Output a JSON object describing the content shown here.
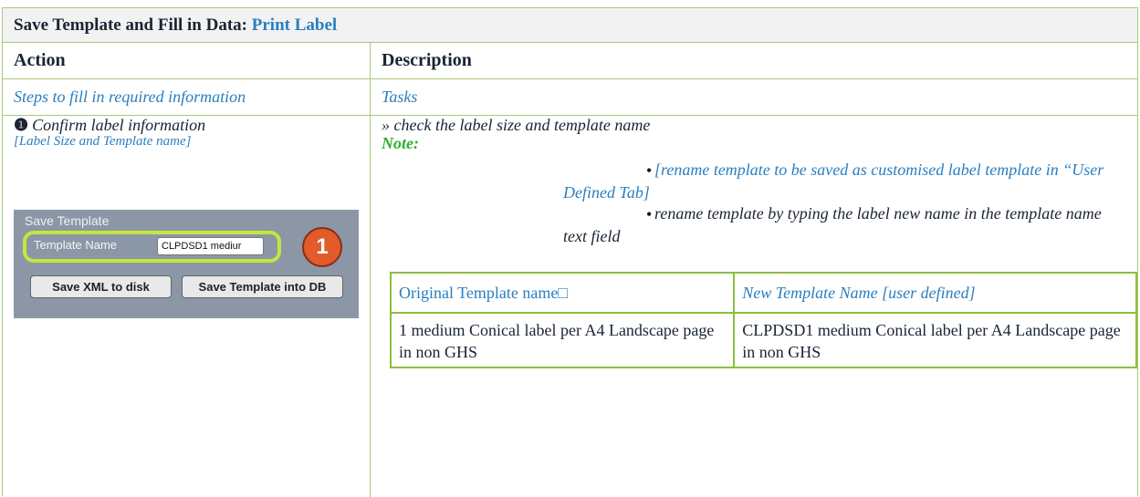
{
  "title": {
    "prefix": "Save Template and Fill in Data: ",
    "highlight": "Print Label"
  },
  "headers": {
    "action": "Action",
    "description": "Description"
  },
  "subheaders": {
    "action": "Steps to fill in required information",
    "description": "Tasks"
  },
  "step": {
    "number_glyph": "❶",
    "label": "Confirm label information",
    "sub": "[Label Size and Template name]"
  },
  "screenshot": {
    "section_title": "Save Template",
    "field_label": "Template Name",
    "field_value": "CLPDSD1 mediur",
    "badge": "1",
    "button_xml": "Save XML to disk",
    "button_db": "Save Template into DB"
  },
  "description": {
    "check": "» check the label size and template name",
    "note": "Note:",
    "bullets": [
      "[rename template to be saved as customised label template in “User Defined Tab]",
      "rename template by typing the label new name in the template name text field"
    ]
  },
  "table": {
    "header": [
      "Original Template name□",
      "New Template Name [user defined]"
    ],
    "row": [
      "1 medium Conical label per A4 Landscape page in non GHS",
      "CLPDSD1 medium Conical label per A4 Landscape page in non GHS"
    ]
  },
  "colors": {
    "border": "#a9c97a",
    "table_border": "#8cbf3e",
    "link_blue": "#2a7fbf",
    "note_green": "#2bb02b",
    "highlight_ring": "#c6e53c",
    "badge": "#e25b2a"
  }
}
